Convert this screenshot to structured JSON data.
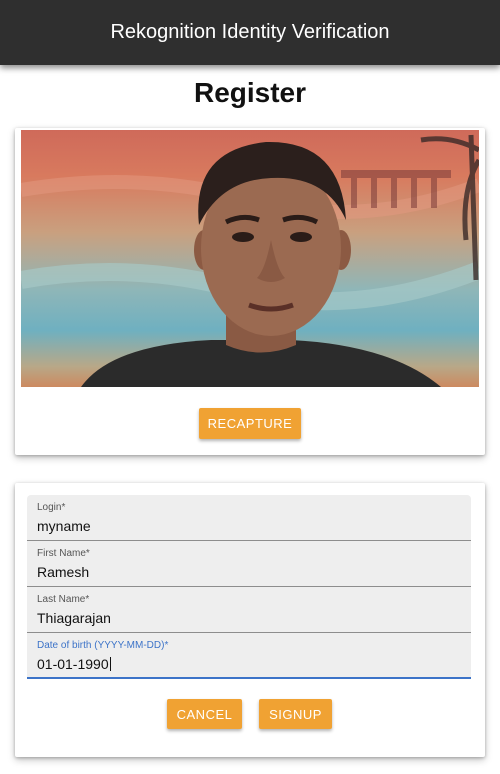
{
  "app": {
    "title": "Rekognition Identity Verification"
  },
  "page": {
    "heading": "Register"
  },
  "photo_card": {
    "recapture_label": "RECAPTURE"
  },
  "form": {
    "fields": [
      {
        "label": "Login",
        "required": "*",
        "value": "myname"
      },
      {
        "label": "First Name",
        "required": "*",
        "value": "Ramesh"
      },
      {
        "label": "Last Name",
        "required": "*",
        "value": "Thiagarajan"
      },
      {
        "label": "Date of birth (YYYY-MM-DD)",
        "required": "*",
        "value": "01-01-1990"
      }
    ],
    "cancel_label": "CANCEL",
    "signup_label": "SIGNUP"
  },
  "colors": {
    "appbar": "#2f2f2f",
    "accent_button": "#f0a233",
    "focus_blue": "#3c73c8",
    "field_background": "#eeeeee"
  }
}
